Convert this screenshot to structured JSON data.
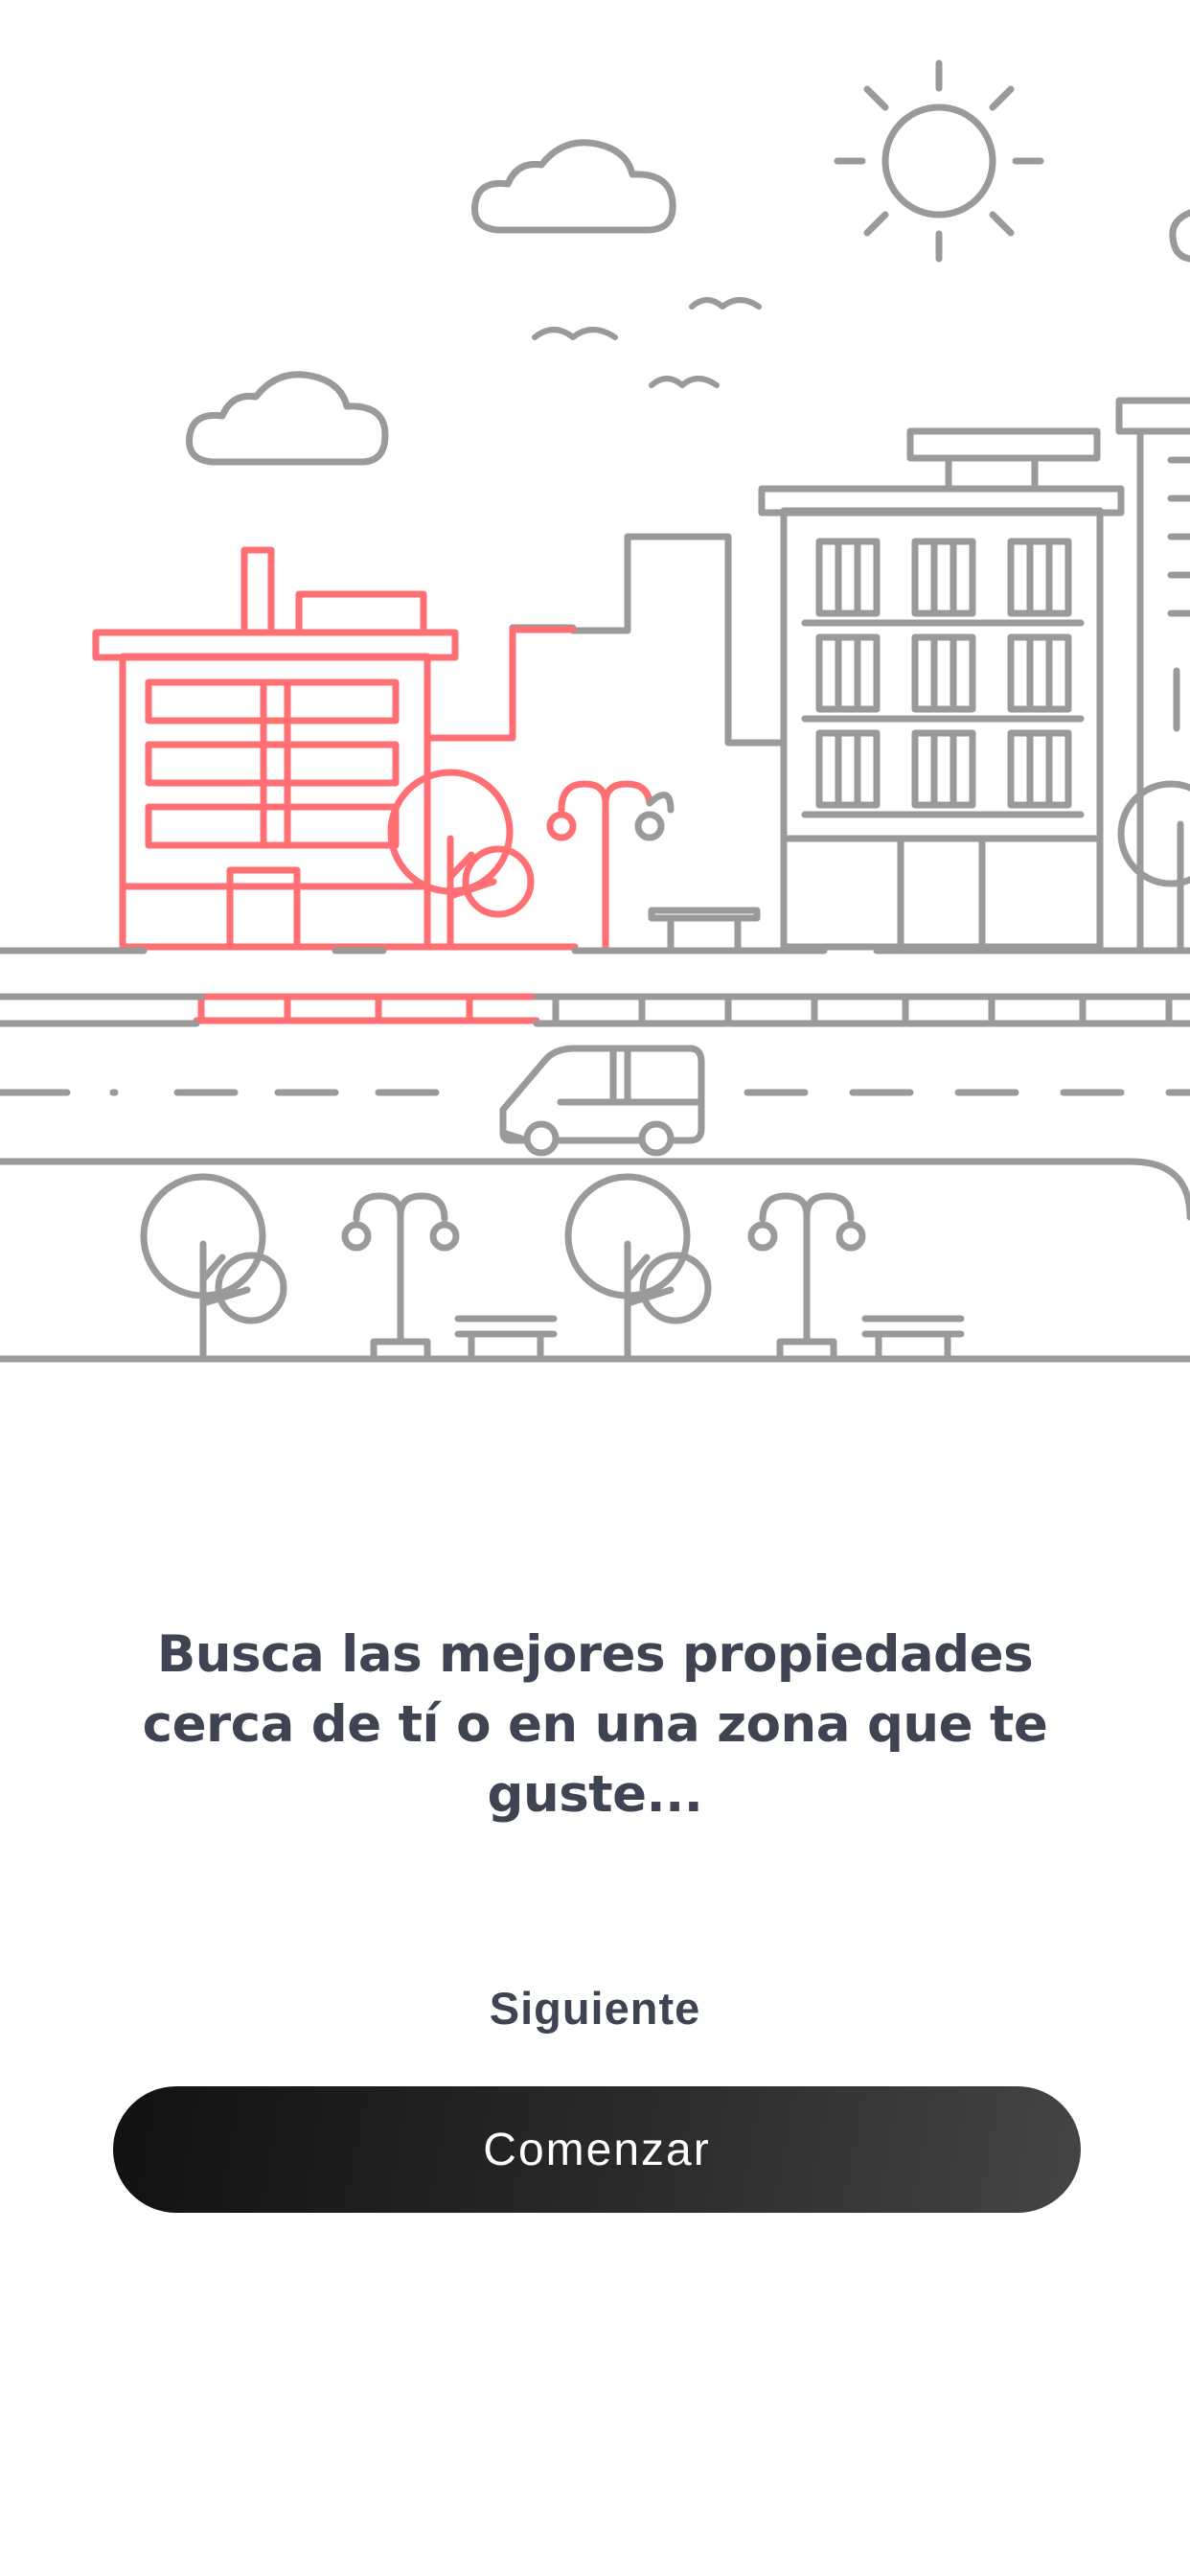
{
  "colors": {
    "line": "#9a9a9a",
    "accent": "#ff6f73",
    "text": "#3f4452",
    "button_bg": "#1e1e1f"
  },
  "illustration": {
    "icon": "city-street-illustration"
  },
  "onboarding": {
    "headline": "Busca las mejores propiedades cerca de tí o en una zona que te guste...",
    "next_label": "Siguiente",
    "start_label": "Comenzar"
  }
}
